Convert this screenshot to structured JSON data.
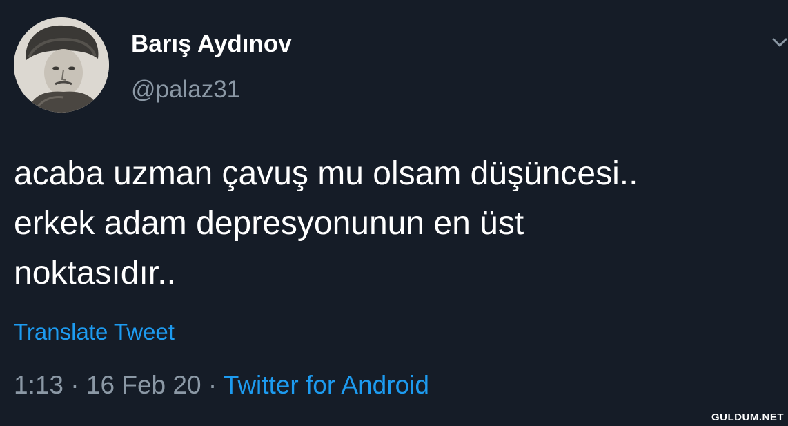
{
  "tweet": {
    "author": {
      "display_name": "Barış Aydınov",
      "handle": "@palaz31",
      "avatar_icon": "profile-photo"
    },
    "menu_icon": "chevron-down-icon",
    "text": "acaba uzman çavuş mu olsam düşüncesi..\nerkek adam depresyonunun en üst\nnoktasıdır..",
    "translate_label": "Translate Tweet",
    "meta": {
      "time": "1:13",
      "separator": " · ",
      "date": "16 Feb 20",
      "source": "Twitter for Android"
    }
  },
  "watermark": {
    "text": "GULDUM.NET"
  },
  "colors": {
    "background": "#151c27",
    "text": "#ffffff",
    "muted": "#8b98a5",
    "link": "#1d9bf0"
  }
}
